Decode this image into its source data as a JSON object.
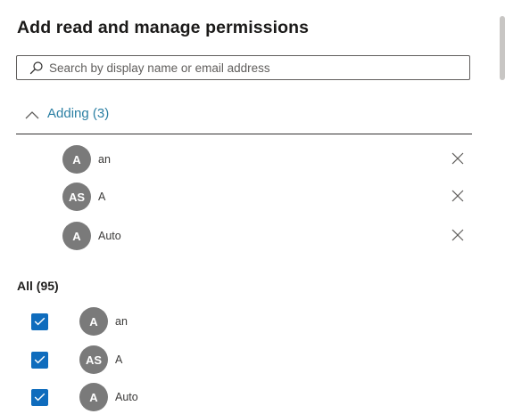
{
  "panel": {
    "title": "Add read and manage permissions"
  },
  "search": {
    "placeholder": "Search by display name or email address",
    "value": ""
  },
  "adding": {
    "label": "Adding (3)",
    "expanded": true,
    "items": [
      {
        "initials": "A",
        "name": "an"
      },
      {
        "initials": "AS",
        "name": "A"
      },
      {
        "initials": "A",
        "name": "Auto"
      }
    ]
  },
  "all": {
    "label": "All (95)",
    "items": [
      {
        "initials": "A",
        "name": "an",
        "checked": true
      },
      {
        "initials": "AS",
        "name": "A",
        "checked": true
      },
      {
        "initials": "A",
        "name": "Auto",
        "checked": true
      }
    ]
  },
  "colors": {
    "accent": "#0f6cbd",
    "link": "#2b7fa3",
    "avatar": "#7a7a7a"
  },
  "icons": {
    "search": "search-icon",
    "collapse": "chevron-up-icon",
    "remove": "close-icon",
    "check": "checkmark-icon"
  }
}
